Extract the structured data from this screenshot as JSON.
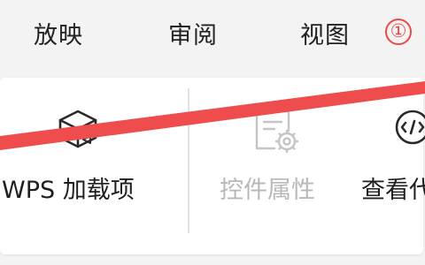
{
  "menu": {
    "items": [
      {
        "label": "放映"
      },
      {
        "label": "审阅"
      },
      {
        "label": "视图"
      }
    ],
    "badge": "①"
  },
  "tools": {
    "wps_addins": {
      "label": "WPS 加载项",
      "icon": "cube-icon"
    },
    "control_properties": {
      "label": "控件属性",
      "icon": "form-settings-icon",
      "disabled": true
    },
    "view_code": {
      "label": "查看代",
      "icon": "code-icon"
    }
  },
  "colors": {
    "annotation_red": "#ef4d4d",
    "disabled_gray": "#b8b8b8",
    "text_dark": "#1f1f1f"
  }
}
